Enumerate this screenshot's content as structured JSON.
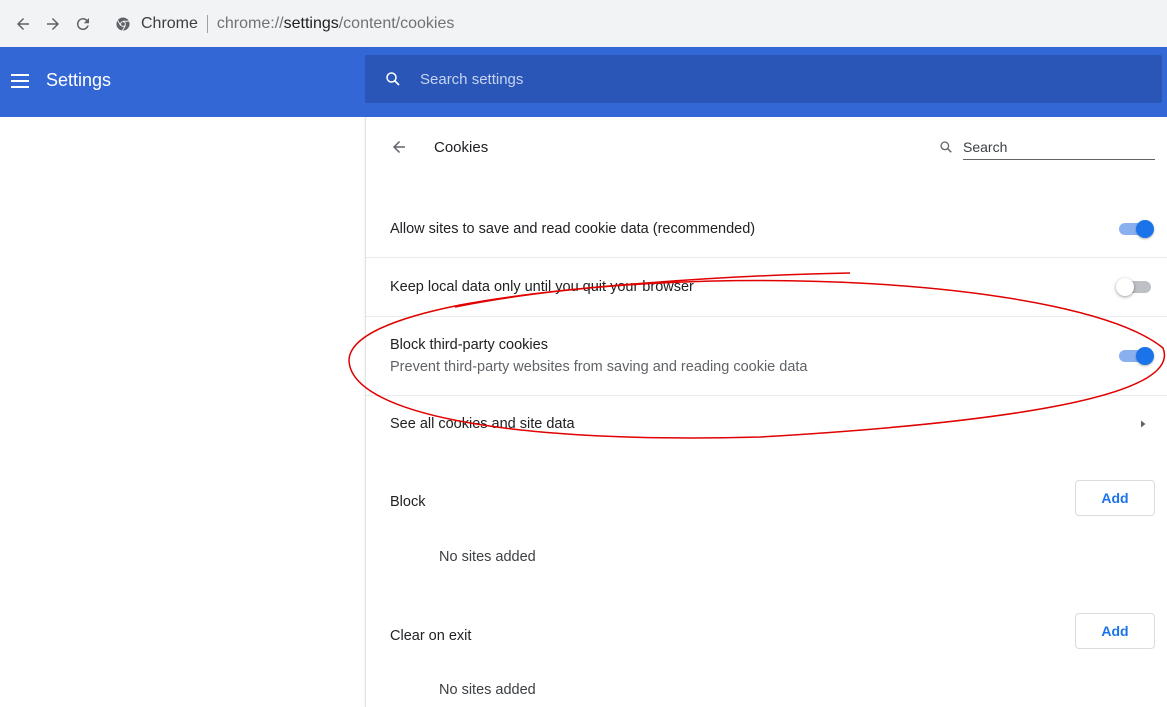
{
  "browser": {
    "app_label": "Chrome",
    "url_prefix": "chrome://",
    "url_host": "settings",
    "url_path": "/content/cookies"
  },
  "header": {
    "title": "Settings",
    "search_placeholder": "Search settings"
  },
  "page": {
    "title": "Cookies",
    "search_placeholder": "Search"
  },
  "rows": [
    {
      "label": "Allow sites to save and read cookie data (recommended)",
      "toggle": true
    },
    {
      "label": "Keep local data only until you quit your browser",
      "toggle": false
    },
    {
      "label": "Block third-party cookies",
      "sublabel": "Prevent third-party websites from saving and reading cookie data",
      "toggle": true
    },
    {
      "label": "See all cookies and site data"
    }
  ],
  "sections": [
    {
      "label": "Block",
      "button": "Add",
      "empty": "No sites added"
    },
    {
      "label": "Clear on exit",
      "button": "Add",
      "empty": "No sites added"
    }
  ],
  "colors": {
    "header_bg": "#3367d6",
    "accent": "#1a73e8",
    "annotation": "#e00000"
  },
  "icons": [
    "back-icon",
    "forward-icon",
    "reload-icon",
    "chrome-logo-icon",
    "menu-icon",
    "search-icon",
    "arrow-left-icon",
    "chevron-right-icon"
  ]
}
